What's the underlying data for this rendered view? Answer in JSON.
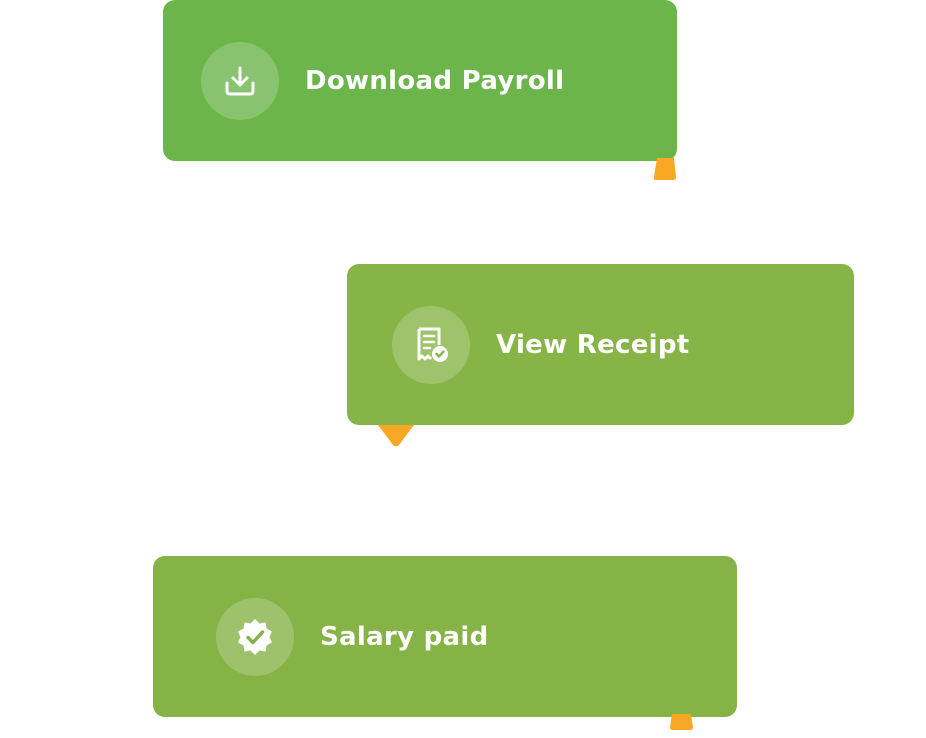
{
  "cards": {
    "download": {
      "label": "Download Payroll",
      "icon": "download-icon"
    },
    "receipt": {
      "label": "View Receipt",
      "icon": "receipt-check-icon"
    },
    "salary": {
      "label": "Salary paid",
      "icon": "verified-badge-icon"
    }
  },
  "colors": {
    "download_card": "#6cb54b",
    "receipt_card": "#86b447",
    "salary_card": "#85b346",
    "tail_accent": "#f9a826",
    "icon_bg": "rgba(255,255,255,0.2)",
    "text": "#ffffff"
  }
}
